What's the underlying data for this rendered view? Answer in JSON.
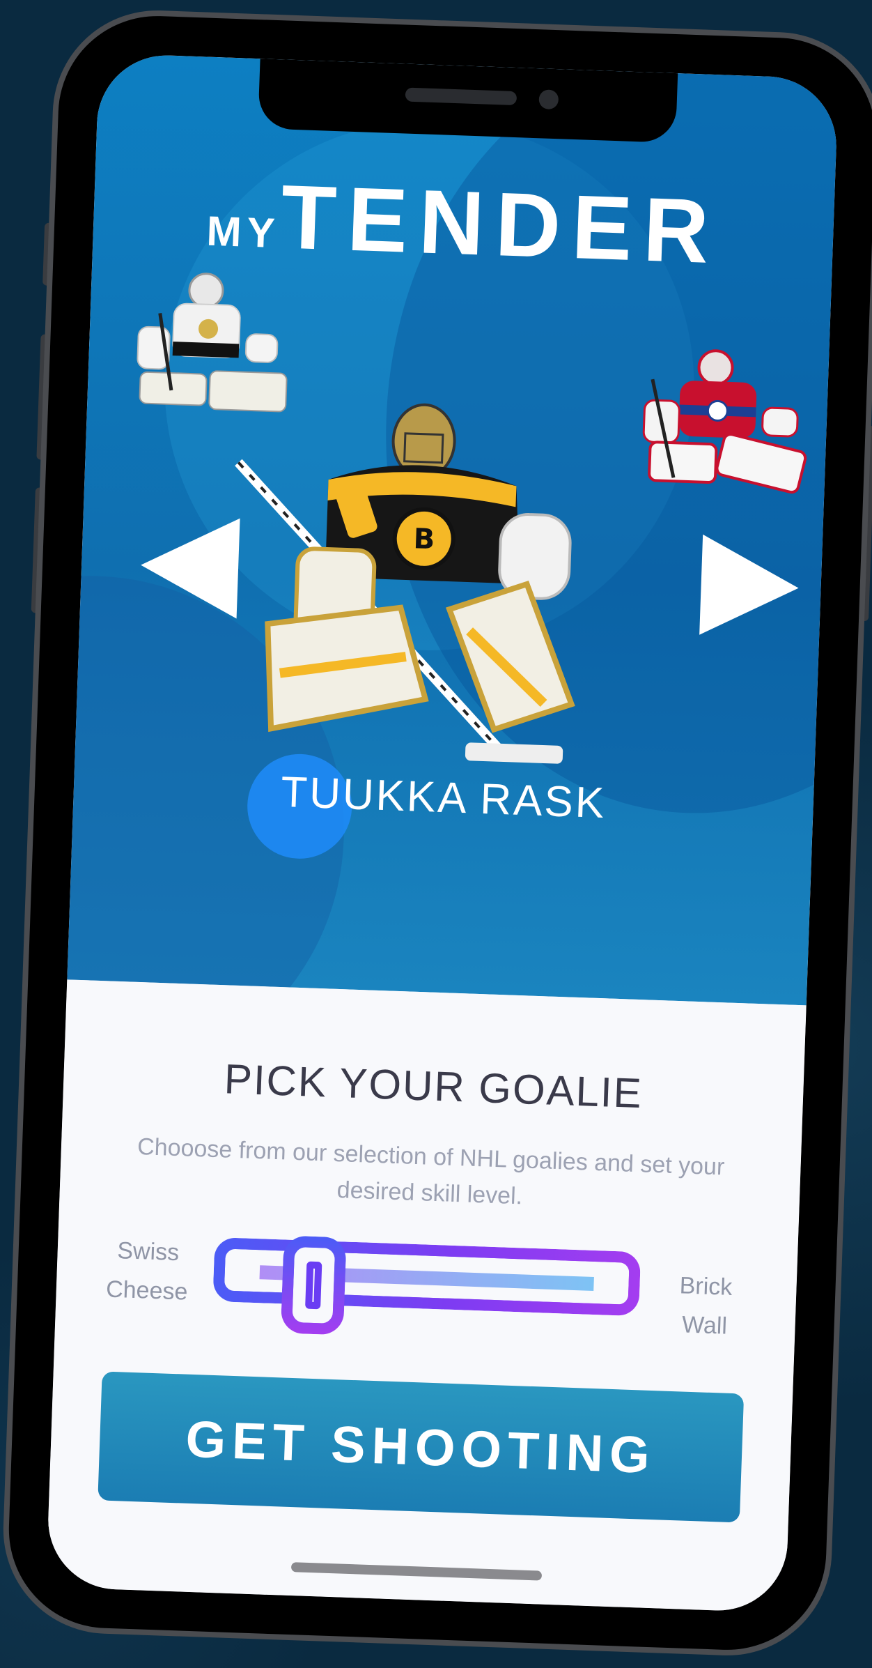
{
  "app": {
    "logo_prefix": "MY",
    "logo_main": "TENDER"
  },
  "carousel": {
    "current_goalie": "TUUKKA RASK",
    "previous_icon": "triangle-left-icon",
    "next_icon": "triangle-right-icon",
    "goalies": [
      {
        "jersey": "penguins",
        "colors": {
          "jersey": "#f2f2f2",
          "trim": "#111111",
          "accent": "#d4b24a"
        }
      },
      {
        "jersey": "bruins",
        "colors": {
          "jersey": "#111111",
          "trim": "#f5b826",
          "accent": "#f0f0f0"
        }
      },
      {
        "jersey": "canadiens",
        "colors": {
          "jersey": "#c8102e",
          "trim": "#1c3f94",
          "accent": "#ffffff"
        }
      }
    ]
  },
  "panel": {
    "title": "PICK YOUR GOALIE",
    "description": "Chooose from our selection of NHL goalies and set your desired skill level."
  },
  "skill_slider": {
    "min_label_line1": "Swiss",
    "min_label_line2": "Cheese",
    "max_label_line1": "Brick",
    "max_label_line2": "Wall",
    "value": 0.17
  },
  "cta": {
    "label": "GET SHOOTING"
  },
  "colors": {
    "hero_blue": "#0d7fc2",
    "button_blue": "#1b7db3",
    "slider_gradient_start": "#4b5cf6",
    "slider_gradient_end": "#a43df0",
    "touch_indicator": "#1e8cfa"
  }
}
